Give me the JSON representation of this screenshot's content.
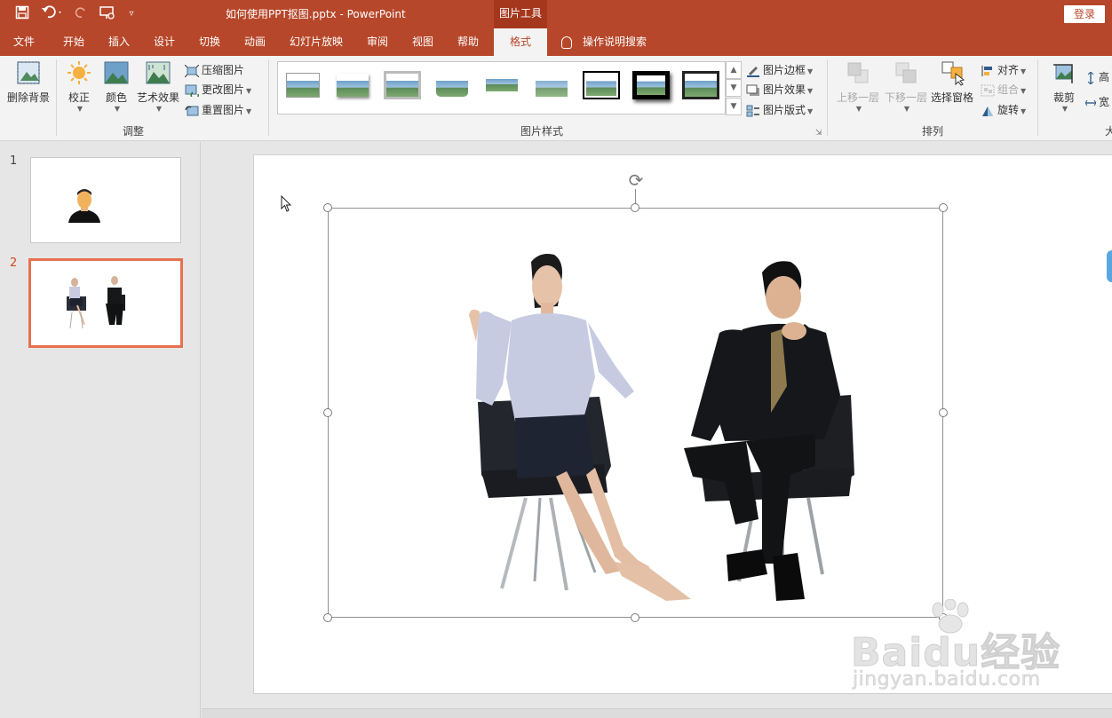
{
  "titlebar": {
    "document_title": "如何使用PPT抠图.pptx  -  PowerPoint",
    "context_tool": "图片工具",
    "login_label": "登录",
    "qat": [
      "save-icon",
      "undo-icon",
      "redo-icon",
      "present-icon",
      "customize-icon"
    ]
  },
  "tabs": [
    {
      "label": "文件"
    },
    {
      "label": "开始"
    },
    {
      "label": "插入"
    },
    {
      "label": "设计"
    },
    {
      "label": "切换"
    },
    {
      "label": "动画"
    },
    {
      "label": "幻灯片放映"
    },
    {
      "label": "审阅"
    },
    {
      "label": "视图"
    },
    {
      "label": "帮助"
    },
    {
      "label": "格式",
      "active": true
    }
  ],
  "tell_me": "操作说明搜索",
  "ribbon": {
    "adjust": {
      "remove_bg": "删除背景",
      "corrections": "校正",
      "color": "颜色",
      "artistic": "艺术效果",
      "compress": "压缩图片",
      "change": "更改图片",
      "reset": "重置图片",
      "label": "调整"
    },
    "styles": {
      "label": "图片样式",
      "border": "图片边框",
      "effects": "图片效果",
      "layout": "图片版式",
      "gallery_count": 9
    },
    "arrange": {
      "label": "排列",
      "bring_forward": "上移一层",
      "send_backward": "下移一层",
      "selection_pane": "选择窗格",
      "align": "对齐",
      "group": "组合",
      "rotate": "旋转"
    },
    "size": {
      "crop": "裁剪",
      "height_partial": "高",
      "width_partial": "宽",
      "label_partial": "大"
    }
  },
  "slides": [
    {
      "number": "1",
      "active": false
    },
    {
      "number": "2",
      "active": true
    }
  ],
  "watermark": {
    "brand": "Baidu经验",
    "url": "jingyan.baidu.com"
  },
  "colors": {
    "accent": "#b7472a",
    "ribbon_bg": "#f3f3f3",
    "active_thumb_border": "#e8704f"
  }
}
